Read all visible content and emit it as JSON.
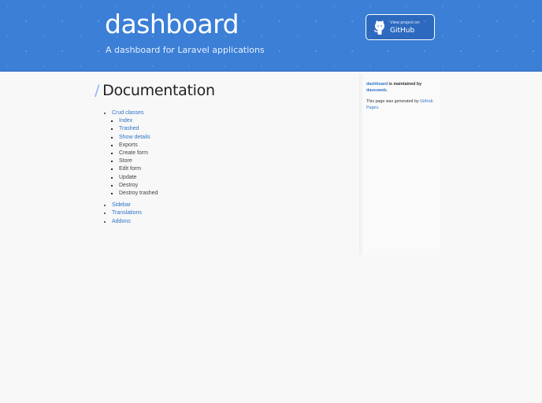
{
  "header": {
    "title": "dashboard",
    "tagline": "A dashboard for Laravel applications",
    "github_button": {
      "small_label": "View project on",
      "big_label": "GitHub",
      "icon": "github-octocat-icon"
    }
  },
  "main": {
    "slash": "/",
    "heading": "Documentation",
    "toc": [
      {
        "label": "Crud classes",
        "children": [
          {
            "label": "Index",
            "link": true
          },
          {
            "label": "Trashed",
            "link": true
          },
          {
            "label": "Show details",
            "link": true
          },
          {
            "label": "Exports",
            "link": false
          },
          {
            "label": "Create form",
            "link": false
          },
          {
            "label": "Store",
            "link": false
          },
          {
            "label": "Edit form",
            "link": false
          },
          {
            "label": "Update",
            "link": false
          },
          {
            "label": "Destroy",
            "link": false
          },
          {
            "label": "Destroy trashed",
            "link": false
          }
        ]
      },
      {
        "label": "Sidebar"
      },
      {
        "label": "Translations"
      },
      {
        "label": "Addons"
      }
    ]
  },
  "sidebar": {
    "project": "dashboard",
    "maintained_text": " is maintained by",
    "maintainer": "davesweb",
    "period": ".",
    "generated_text": "This page was generated by ",
    "generator": "GitHub Pages",
    "generator_period": "."
  },
  "colors": {
    "header_bg": "#3b7fd6",
    "link": "#2f73c9",
    "page_bg": "#f8f8f8"
  }
}
